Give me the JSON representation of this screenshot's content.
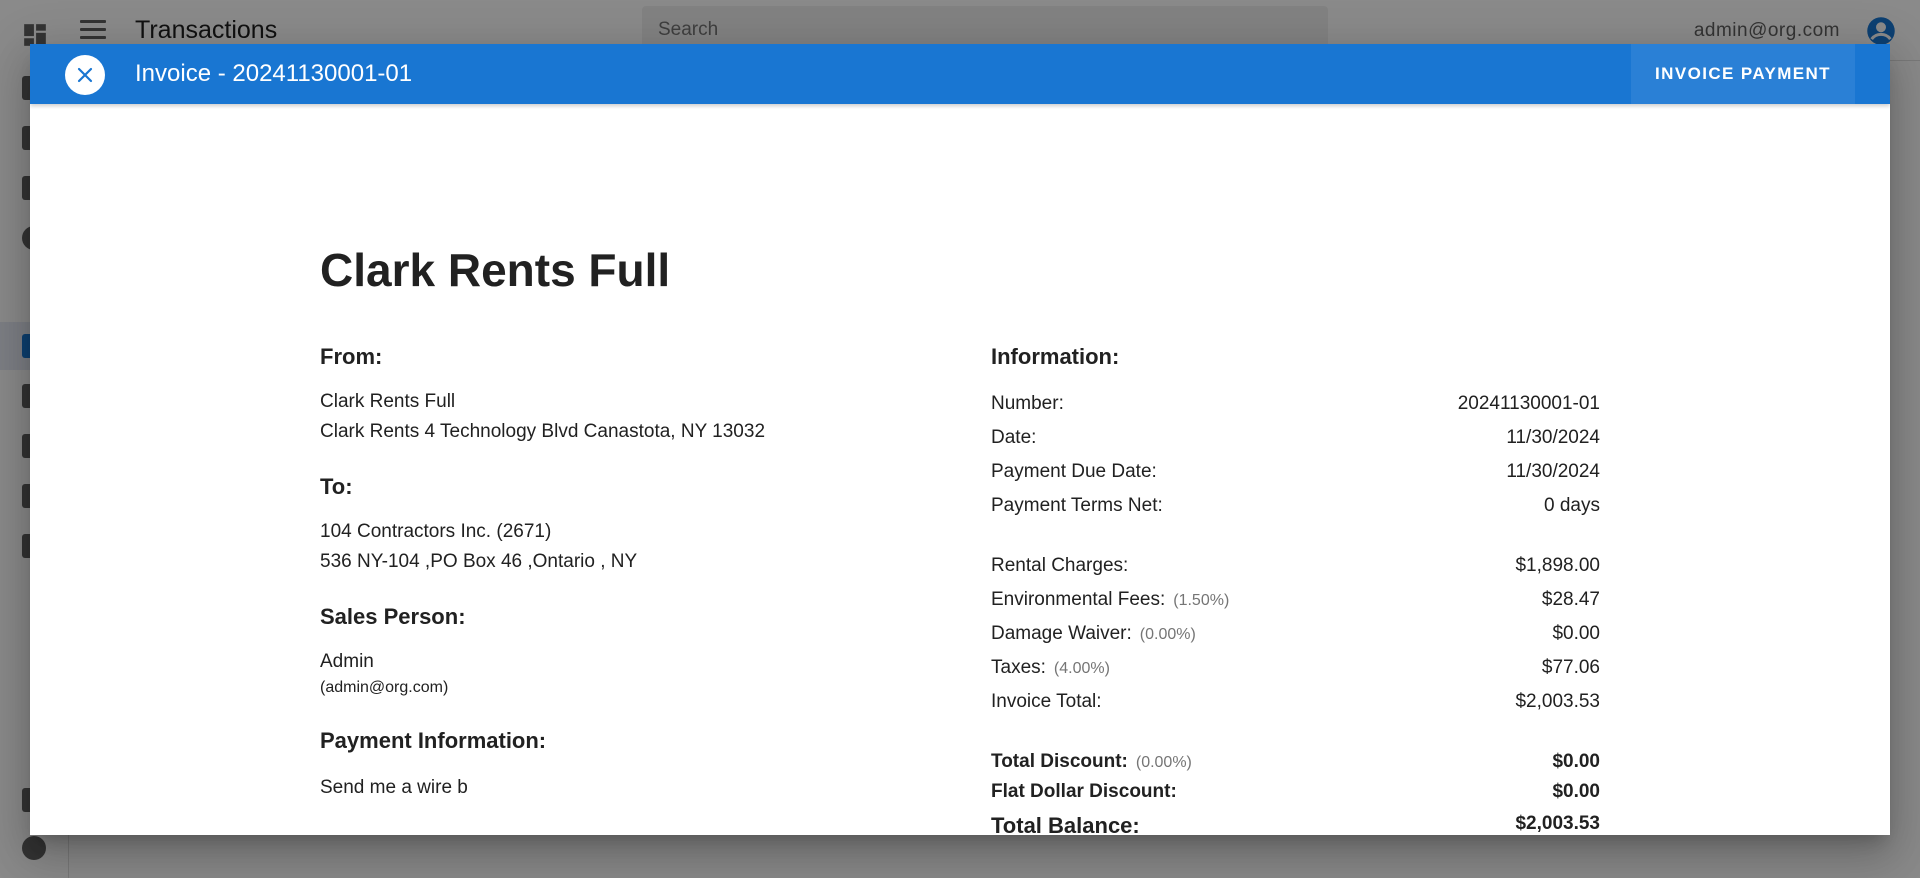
{
  "app": {
    "title": "Transactions",
    "search_placeholder": "Search",
    "user_email": "admin@org.com"
  },
  "dialog": {
    "title": "Invoice - 20241130001-01",
    "invoice_payment_label": "INVOICE PAYMENT",
    "company_name": "Clark Rents Full",
    "from": {
      "heading": "From:",
      "line1": "Clark Rents Full",
      "line2": "Clark Rents 4 Technology Blvd Canastota, NY 13032"
    },
    "to": {
      "heading": "To:",
      "line1": "104 Contractors Inc. (2671)",
      "line2": "536 NY-104 ,PO Box 46 ,Ontario , NY"
    },
    "sales_person": {
      "heading": "Sales Person:",
      "name": "Admin",
      "email": "(admin@org.com)"
    },
    "payment_info": {
      "heading": "Payment Information:",
      "text": "Send me a wire b"
    },
    "information": {
      "heading": "Information:",
      "rows": [
        {
          "label": "Number:",
          "value": "20241130001-01"
        },
        {
          "label": "Date:",
          "value": "11/30/2024"
        },
        {
          "label": "Payment Due Date:",
          "value": "11/30/2024"
        },
        {
          "label": "Payment Terms Net:",
          "value": "0 days"
        }
      ],
      "charges": [
        {
          "label": "Rental Charges:",
          "pct": "",
          "value": "$1,898.00"
        },
        {
          "label": "Environmental Fees:",
          "pct": "(1.50%)",
          "value": "$28.47"
        },
        {
          "label": "Damage Waiver:",
          "pct": "(0.00%)",
          "value": "$0.00"
        },
        {
          "label": "Taxes:",
          "pct": "(4.00%)",
          "value": "$77.06"
        },
        {
          "label": "Invoice Total:",
          "pct": "",
          "value": "$2,003.53"
        }
      ],
      "totals": [
        {
          "label": "Total Discount:",
          "pct": "(0.00%)",
          "value": "$0.00"
        },
        {
          "label": "Flat Dollar Discount:",
          "pct": "",
          "value": "$0.00"
        },
        {
          "label": "Total Balance:",
          "pct": "",
          "value": "$2,003.53"
        }
      ]
    }
  },
  "colors": {
    "primary": "#1976d2",
    "scrim": "rgba(0,0,0,0.46)",
    "muted_text": "#757575"
  },
  "icons": {
    "close": "close-icon",
    "apps": "apps-icon",
    "menu": "menu-icon",
    "account": "account-circle-icon"
  }
}
